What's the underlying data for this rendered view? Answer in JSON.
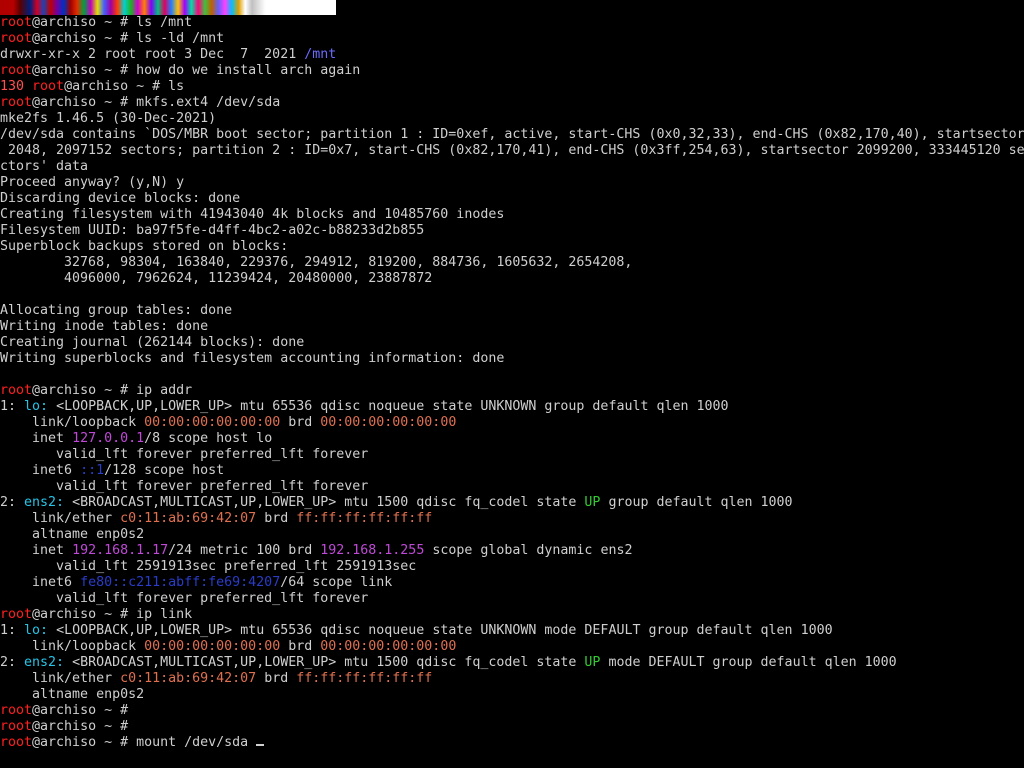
{
  "colors": {
    "background": "#000000",
    "default_text": "#cfcfcf",
    "prompt_user": "#ff2020",
    "exit_code": "#ff5050",
    "iface": "#27c3e6",
    "state_up": "#33cc33",
    "ip_addr": "#c04ad8",
    "mac_addr": "#e07050",
    "link_path": "#6a6aff"
  },
  "terminal": {
    "lines": [
      [
        {
          "t": "root",
          "c": "red"
        },
        {
          "t": "@archiso ~ # ls /mnt",
          "c": "default"
        }
      ],
      [
        {
          "t": "root",
          "c": "red"
        },
        {
          "t": "@archiso ~ # ls -ld /mnt",
          "c": "default"
        }
      ],
      [
        {
          "t": "drwxr-xr-x 2 root root 3 Dec  7  2021 ",
          "c": "default"
        },
        {
          "t": "/mnt",
          "c": "blue"
        }
      ],
      [
        {
          "t": "root",
          "c": "red"
        },
        {
          "t": "@archiso ~ # how do we install arch again",
          "c": "default"
        }
      ],
      [
        {
          "t": "130 ",
          "c": "pink"
        },
        {
          "t": "root",
          "c": "red"
        },
        {
          "t": "@archiso ~ # ls",
          "c": "default"
        }
      ],
      [
        {
          "t": "root",
          "c": "red"
        },
        {
          "t": "@archiso ~ # mkfs.ext4 /dev/sda",
          "c": "default"
        }
      ],
      [
        {
          "t": "mke2fs 1.46.5 (30-Dec-2021)",
          "c": "default"
        }
      ],
      [
        {
          "t": "/dev/sda contains `DOS/MBR boot sector; partition 1 : ID=0xef, active, start-CHS (0x0,32,33), end-CHS (0x82,170,40), startsector",
          "c": "default"
        }
      ],
      [
        {
          "t": " 2048, 2097152 sectors; partition 2 : ID=0x7, start-CHS (0x82,170,41), end-CHS (0x3ff,254,63), startsector 2099200, 333445120 se",
          "c": "default"
        }
      ],
      [
        {
          "t": "ctors' data",
          "c": "default"
        }
      ],
      [
        {
          "t": "Proceed anyway? (y,N) y",
          "c": "default"
        }
      ],
      [
        {
          "t": "Discarding device blocks: done",
          "c": "default"
        }
      ],
      [
        {
          "t": "Creating filesystem with 41943040 4k blocks and 10485760 inodes",
          "c": "default"
        }
      ],
      [
        {
          "t": "Filesystem UUID: ba97f5fe-d4ff-4bc2-a02c-b88233d2b855",
          "c": "default"
        }
      ],
      [
        {
          "t": "Superblock backups stored on blocks:",
          "c": "default"
        }
      ],
      [
        {
          "t": "        32768, 98304, 163840, 229376, 294912, 819200, 884736, 1605632, 2654208,",
          "c": "default"
        }
      ],
      [
        {
          "t": "        4096000, 7962624, 11239424, 20480000, 23887872",
          "c": "default"
        }
      ],
      [
        {
          "t": "",
          "c": "default"
        }
      ],
      [
        {
          "t": "Allocating group tables: done",
          "c": "default"
        }
      ],
      [
        {
          "t": "Writing inode tables: done",
          "c": "default"
        }
      ],
      [
        {
          "t": "Creating journal (262144 blocks): done",
          "c": "default"
        }
      ],
      [
        {
          "t": "Writing superblocks and filesystem accounting information: done",
          "c": "default"
        }
      ],
      [
        {
          "t": "",
          "c": "default"
        }
      ],
      [
        {
          "t": "root",
          "c": "red"
        },
        {
          "t": "@archiso ~ # ip addr",
          "c": "default"
        }
      ],
      [
        {
          "t": "1: ",
          "c": "default"
        },
        {
          "t": "lo:",
          "c": "cyan"
        },
        {
          "t": " <LOOPBACK,UP,LOWER_UP> mtu 65536 qdisc noqueue state UNKNOWN group default qlen 1000",
          "c": "default"
        }
      ],
      [
        {
          "t": "    link/loopback ",
          "c": "default"
        },
        {
          "t": "00:00:00:00:00:00",
          "c": "orange"
        },
        {
          "t": " brd ",
          "c": "default"
        },
        {
          "t": "00:00:00:00:00:00",
          "c": "orange"
        }
      ],
      [
        {
          "t": "    inet ",
          "c": "default"
        },
        {
          "t": "127.0.0.1",
          "c": "purple"
        },
        {
          "t": "/8 scope host lo",
          "c": "default"
        }
      ],
      [
        {
          "t": "       valid_lft forever preferred_lft forever",
          "c": "default"
        }
      ],
      [
        {
          "t": "    inet6 ",
          "c": "default"
        },
        {
          "t": "::1",
          "c": "darkblue"
        },
        {
          "t": "/128 scope host",
          "c": "default"
        }
      ],
      [
        {
          "t": "       valid_lft forever preferred_lft forever",
          "c": "default"
        }
      ],
      [
        {
          "t": "2: ",
          "c": "default"
        },
        {
          "t": "ens2:",
          "c": "cyan"
        },
        {
          "t": " <BROADCAST,MULTICAST,UP,LOWER_UP> mtu 1500 qdisc fq_codel state ",
          "c": "default"
        },
        {
          "t": "UP",
          "c": "green"
        },
        {
          "t": " group default qlen 1000",
          "c": "default"
        }
      ],
      [
        {
          "t": "    link/ether ",
          "c": "default"
        },
        {
          "t": "c0:11:ab:69:42:07",
          "c": "orange"
        },
        {
          "t": " brd ",
          "c": "default"
        },
        {
          "t": "ff:ff:ff:ff:ff:ff",
          "c": "orange"
        }
      ],
      [
        {
          "t": "    altname enp0s2",
          "c": "default"
        }
      ],
      [
        {
          "t": "    inet ",
          "c": "default"
        },
        {
          "t": "192.168.1.17",
          "c": "purple"
        },
        {
          "t": "/24 metric 100 brd ",
          "c": "default"
        },
        {
          "t": "192.168.1.255",
          "c": "purple"
        },
        {
          "t": " scope global dynamic ens2",
          "c": "default"
        }
      ],
      [
        {
          "t": "       valid_lft 2591913sec preferred_lft 2591913sec",
          "c": "default"
        }
      ],
      [
        {
          "t": "    inet6 ",
          "c": "default"
        },
        {
          "t": "fe80::c211:abff:fe69:4207",
          "c": "darkblue"
        },
        {
          "t": "/64 scope link",
          "c": "default"
        }
      ],
      [
        {
          "t": "       valid_lft forever preferred_lft forever",
          "c": "default"
        }
      ],
      [
        {
          "t": "root",
          "c": "red"
        },
        {
          "t": "@archiso ~ # ip link",
          "c": "default"
        }
      ],
      [
        {
          "t": "1: ",
          "c": "default"
        },
        {
          "t": "lo:",
          "c": "cyan"
        },
        {
          "t": " <LOOPBACK,UP,LOWER_UP> mtu 65536 qdisc noqueue state UNKNOWN mode DEFAULT group default qlen 1000",
          "c": "default"
        }
      ],
      [
        {
          "t": "    link/loopback ",
          "c": "default"
        },
        {
          "t": "00:00:00:00:00:00",
          "c": "orange"
        },
        {
          "t": " brd ",
          "c": "default"
        },
        {
          "t": "00:00:00:00:00:00",
          "c": "orange"
        }
      ],
      [
        {
          "t": "2: ",
          "c": "default"
        },
        {
          "t": "ens2:",
          "c": "cyan"
        },
        {
          "t": " <BROADCAST,MULTICAST,UP,LOWER_UP> mtu 1500 qdisc fq_codel state ",
          "c": "default"
        },
        {
          "t": "UP",
          "c": "green"
        },
        {
          "t": " mode DEFAULT group default qlen 1000",
          "c": "default"
        }
      ],
      [
        {
          "t": "    link/ether ",
          "c": "default"
        },
        {
          "t": "c0:11:ab:69:42:07",
          "c": "orange"
        },
        {
          "t": " brd ",
          "c": "default"
        },
        {
          "t": "ff:ff:ff:ff:ff:ff",
          "c": "orange"
        }
      ],
      [
        {
          "t": "    altname enp0s2",
          "c": "default"
        }
      ],
      [
        {
          "t": "root",
          "c": "red"
        },
        {
          "t": "@archiso ~ #",
          "c": "default"
        }
      ],
      [
        {
          "t": "root",
          "c": "red"
        },
        {
          "t": "@archiso ~ #",
          "c": "default"
        }
      ],
      [
        {
          "t": "root",
          "c": "red"
        },
        {
          "t": "@archiso ~ # mount /dev/sda ",
          "c": "default"
        }
      ]
    ]
  }
}
